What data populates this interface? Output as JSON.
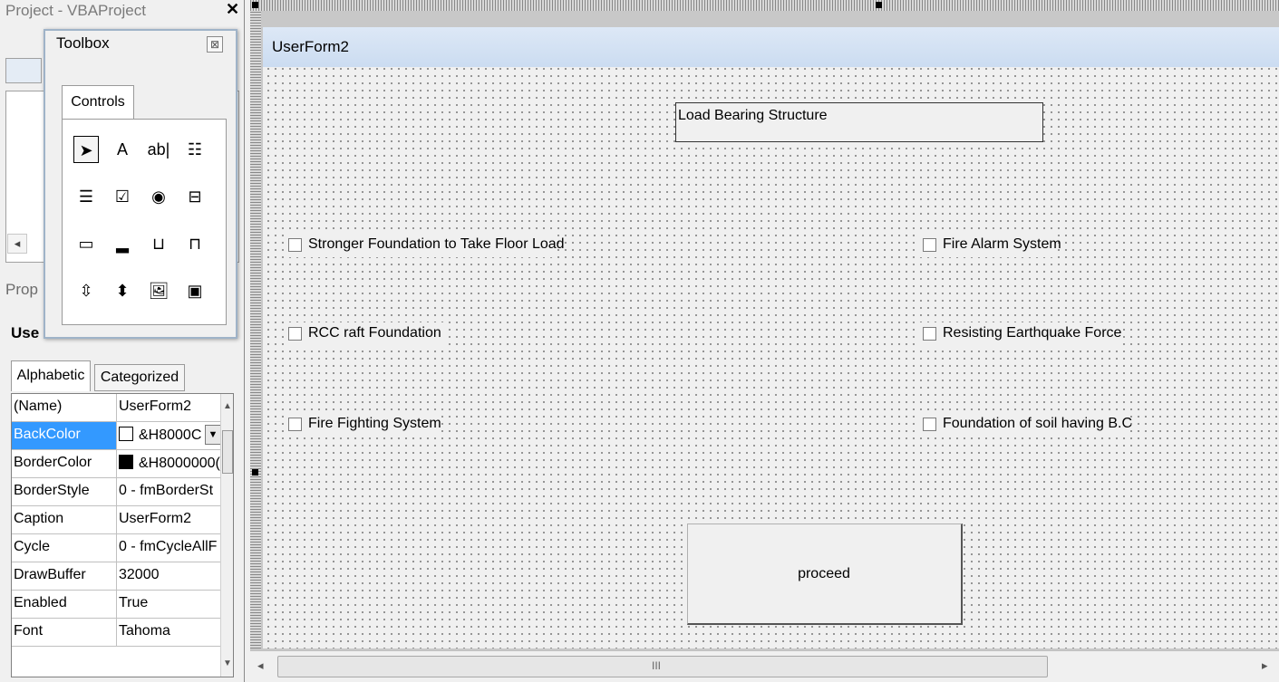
{
  "project": {
    "title": "Project - VBAProject",
    "close_glyph": "✕"
  },
  "toolbox": {
    "title": "Toolbox",
    "close_glyph": "⊠",
    "tab": "Controls",
    "tools": [
      {
        "name": "select-objects-tool",
        "glyph": "➤"
      },
      {
        "name": "label-tool",
        "glyph": "A"
      },
      {
        "name": "textbox-tool",
        "glyph": "ab|"
      },
      {
        "name": "combobox-tool",
        "glyph": "☷"
      },
      {
        "name": "listbox-tool",
        "glyph": "☰"
      },
      {
        "name": "checkbox-tool",
        "glyph": "☑"
      },
      {
        "name": "optionbutton-tool",
        "glyph": "◉"
      },
      {
        "name": "togglebutton-tool",
        "glyph": "⊟"
      },
      {
        "name": "frame-tool",
        "glyph": "▭"
      },
      {
        "name": "commandbutton-tool",
        "glyph": "▂"
      },
      {
        "name": "tabstrip-tool",
        "glyph": "⊔"
      },
      {
        "name": "multipage-tool",
        "glyph": "⊓"
      },
      {
        "name": "scrollbar-tool",
        "glyph": "⇳"
      },
      {
        "name": "spinbutton-tool",
        "glyph": "⬍"
      },
      {
        "name": "image-tool",
        "glyph": "🖼"
      },
      {
        "name": "refedit-tool",
        "glyph": "▣"
      }
    ]
  },
  "properties": {
    "title": "Prop",
    "object_name": "Use",
    "tabs": [
      "Alphabetic",
      "Categorized"
    ],
    "rows": [
      {
        "name": "(Name)",
        "value": "UserForm2"
      },
      {
        "name": "BackColor",
        "value": "&H8000C"
      },
      {
        "name": "BorderColor",
        "value": "&H8000000("
      },
      {
        "name": "BorderStyle",
        "value": "0 - fmBorderSt"
      },
      {
        "name": "Caption",
        "value": "UserForm2"
      },
      {
        "name": "Cycle",
        "value": "0 - fmCycleAllF"
      },
      {
        "name": "DrawBuffer",
        "value": "32000"
      },
      {
        "name": "Enabled",
        "value": "True"
      },
      {
        "name": "Font",
        "value": "Tahoma"
      }
    ],
    "selected_row": "BackColor"
  },
  "userform": {
    "title": "UserForm2",
    "label": "Load Bearing Structure",
    "checkboxes": [
      {
        "label": "Stronger Foundation to Take Floor Load",
        "checked": false
      },
      {
        "label": "Fire Alarm System",
        "checked": false
      },
      {
        "label": "RCC raft Foundation",
        "checked": false
      },
      {
        "label": "Resisting Earthquake Force",
        "checked": false
      },
      {
        "label": "Fire Fighting System",
        "checked": false
      },
      {
        "label": "Foundation of soil having B.C",
        "checked": false
      }
    ],
    "button": "proceed"
  },
  "scrollbar": {
    "left_arrow": "◂",
    "right_arrow": "▸",
    "grip": "III"
  },
  "colors": {
    "selection": "#3399ff",
    "form_title_bar": "#d4e2f4",
    "form_background": "#f0f0f0"
  }
}
